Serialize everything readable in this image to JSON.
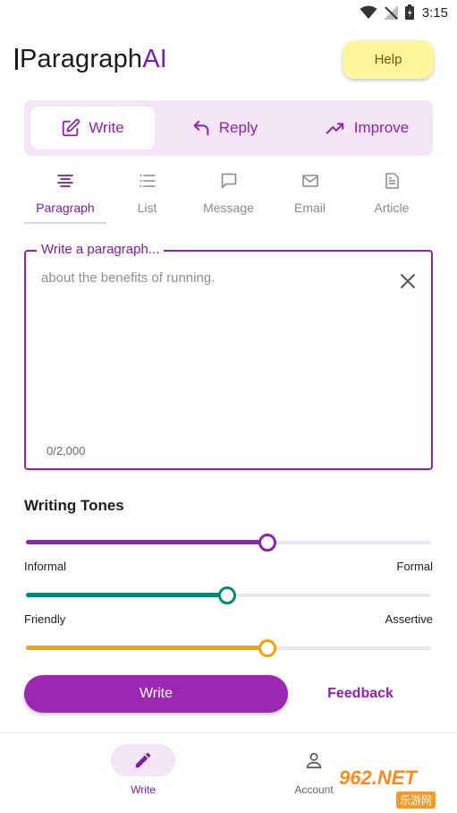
{
  "status": {
    "time": "3:15"
  },
  "header": {
    "logo_main": "Paragraph",
    "logo_accent": "AI",
    "help_label": "Help"
  },
  "modes": [
    {
      "label": "Write",
      "icon": "edit-square-icon",
      "active": true
    },
    {
      "label": "Reply",
      "icon": "reply-arrow-icon",
      "active": false
    },
    {
      "label": "Improve",
      "icon": "trending-up-icon",
      "active": false
    }
  ],
  "types": [
    {
      "label": "Paragraph",
      "icon": "paragraph-icon",
      "active": true
    },
    {
      "label": "List",
      "icon": "list-icon",
      "active": false
    },
    {
      "label": "Message",
      "icon": "message-icon",
      "active": false
    },
    {
      "label": "Email",
      "icon": "email-icon",
      "active": false
    },
    {
      "label": "Article",
      "icon": "article-icon",
      "active": false
    }
  ],
  "input": {
    "label": "Write a paragraph...",
    "value": "",
    "placeholder": "about the benefits of running.",
    "counter": "0/2,000"
  },
  "tones": {
    "title": "Writing Tones",
    "sliders": [
      {
        "left_label": "Informal",
        "right_label": "Formal",
        "value": 0.595,
        "color": "#8e24aa"
      },
      {
        "left_label": "Friendly",
        "right_label": "Assertive",
        "value": 0.497,
        "color": "#00897b"
      },
      {
        "left_label": "",
        "right_label": "",
        "value": 0.595,
        "color": "#f4a20b"
      }
    ]
  },
  "actions": {
    "write_label": "Write",
    "feedback_label": "Feedback"
  },
  "bottom_nav": [
    {
      "label": "Write",
      "icon": "pencil-icon",
      "active": true
    },
    {
      "label": "Account",
      "icon": "person-icon",
      "active": false
    }
  ],
  "watermark": {
    "main": "962.NET",
    "sub": "乐游网"
  },
  "colors": {
    "accent": "#8e24aa",
    "accent_light": "#f3e5f5",
    "help_bg": "#fff59d"
  }
}
